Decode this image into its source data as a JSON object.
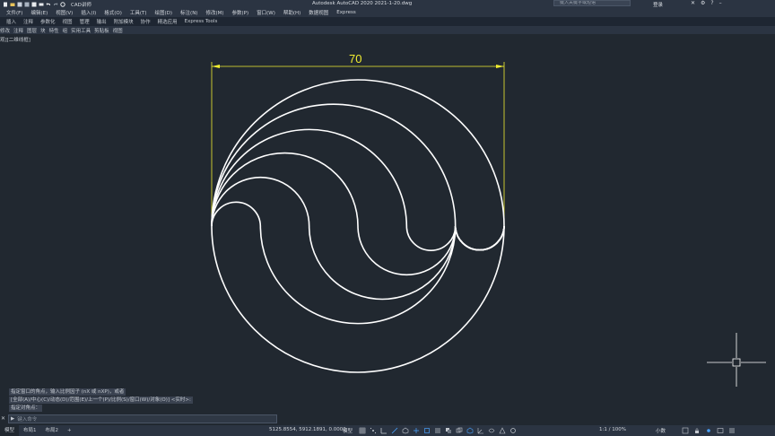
{
  "titlebar": {
    "workspace": "CAD讲师",
    "title": "Autodesk AutoCAD 2020    2021-1-20.dwg",
    "search_placeholder": "键入关键字或短语",
    "login": "登录"
  },
  "menubar": {
    "items": [
      "文件(F)",
      "编辑(E)",
      "视图(V)",
      "插入(I)",
      "格式(O)",
      "工具(T)",
      "绘图(D)",
      "标注(N)",
      "修改(M)",
      "参数(P)",
      "窗口(W)",
      "帮助(H)",
      "数据视图",
      "Express"
    ]
  },
  "ribbon_tabs": {
    "items": [
      "插入",
      "注释",
      "参数化",
      "视图",
      "管理",
      "输出",
      "附加模块",
      "协作",
      "精选应用",
      "Express Tools"
    ]
  },
  "panel_bar": {
    "items": [
      "修改",
      "注释",
      "图层",
      "块",
      "特性",
      "组",
      "实用工具",
      "剪贴板",
      "视图"
    ]
  },
  "viewport": {
    "label": "观][二维线框]"
  },
  "drawing": {
    "dimension_value": "70",
    "colors": {
      "curves": "#ffffff",
      "dimension": "#f2ee30",
      "background": "#212830"
    }
  },
  "command": {
    "history": [
      "指定窗口的角点，输入比例因子 (nX 或 nXP)，或者",
      "[全部(A)/中心(C)/动态(D)/范围(E)/上一个(P)/比例(S)/窗口(W)/对象(O)] <实时>:",
      "指定对角点："
    ],
    "placeholder": "键入命令"
  },
  "statusbar": {
    "layout_tabs": [
      "模型",
      "布局1",
      "布局2",
      "+"
    ],
    "coordinates": "5125.8554, 5912.1891, 0.0000",
    "model": "模型",
    "scale": "1:1 / 100%",
    "units": "小数"
  }
}
